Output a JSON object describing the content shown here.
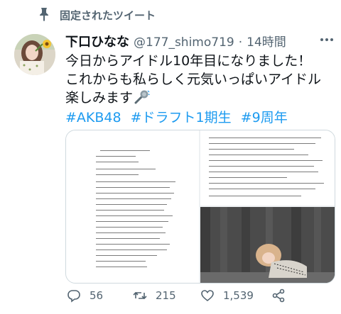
{
  "pinned": {
    "label": "固定されたツイート",
    "icon": "pin-icon"
  },
  "author": {
    "name": "下口ひなな",
    "handle": "@177_shimo719",
    "separator": "·",
    "time": "14時間"
  },
  "tweet": {
    "lines": [
      "今日からアイドル10年目になりました！",
      "これからも私らしく元気いっぱいアイドル",
      "楽しみます"
    ],
    "hashtags": [
      "#AKB48",
      "#ドラフト1期生",
      "#9周年"
    ],
    "emoji_icon": "microphone-icon"
  },
  "media": {
    "images": [
      "letter-page-left",
      "letter-page-right",
      "photo-of-woman"
    ]
  },
  "actions": {
    "reply": {
      "icon": "reply-icon",
      "count": "56"
    },
    "retweet": {
      "icon": "retweet-icon",
      "count": "215"
    },
    "like": {
      "icon": "heart-icon",
      "count": "1,539"
    },
    "share": {
      "icon": "share-icon"
    }
  },
  "colors": {
    "link": "#1d9bf0",
    "secondary_text": "#536471",
    "primary_text": "#0f1419",
    "border": "#cfd9de"
  }
}
